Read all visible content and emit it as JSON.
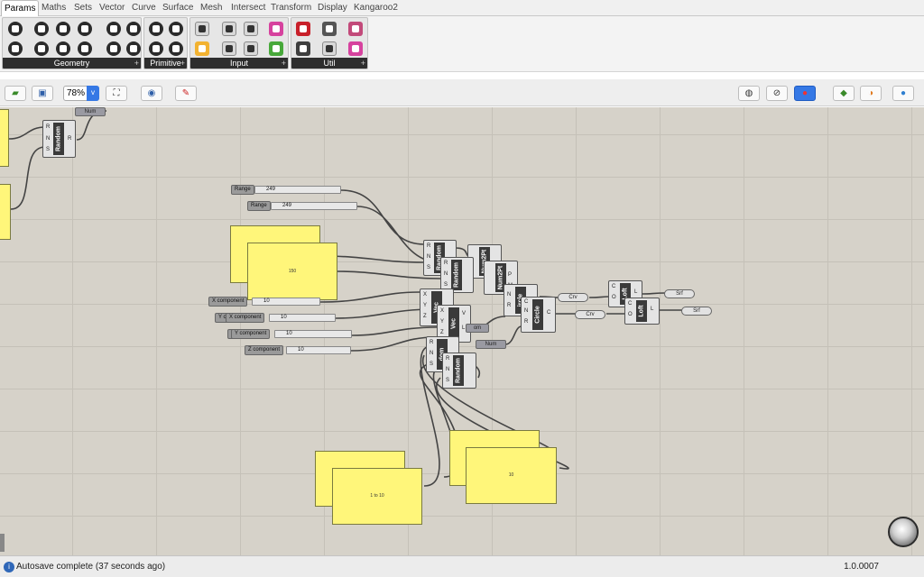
{
  "tabs": [
    "Params",
    "Maths",
    "Sets",
    "Vector",
    "Curve",
    "Surface",
    "Mesh",
    "Intersect",
    "Transform",
    "Display",
    "Kangaroo2"
  ],
  "active_tab": "Params",
  "ribbon": {
    "panels": [
      {
        "label": "Geometry",
        "more": "+"
      },
      {
        "label": "Primitive",
        "more": "+"
      },
      {
        "label": "Input",
        "more": "+"
      },
      {
        "label": "Util",
        "more": "+"
      }
    ],
    "primitive_icons": [
      "0",
      "01",
      "7",
      "A"
    ]
  },
  "toolbar": {
    "zoom": "78%",
    "zoom_arrow": "v",
    "icons": [
      "open-file-icon",
      "save-icon",
      "zoom-extents-icon",
      "eye-icon",
      "sketch-icon",
      "preview-wire-icon",
      "preview-shade-icon",
      "preview-selected-icon",
      "solid-preview-icon",
      "material-preview-icon",
      "sphere-preview-icon"
    ]
  },
  "canvas": {
    "components": {
      "random": "Random",
      "num2pt": "Num2Pt",
      "circle": "Circle",
      "vec": "Vec",
      "loft": "Loft"
    },
    "pins": {
      "r": "R",
      "n": "N",
      "s": "S",
      "x": "X",
      "y": "Y",
      "z": "Z",
      "c": "C",
      "p": "P",
      "m": "M",
      "o": "O",
      "l": "L",
      "v": "V"
    },
    "params": {
      "num": "Num",
      "crv": "Crv",
      "srf": "Srf"
    },
    "sliders": [
      {
        "label": "Range",
        "value": "249"
      },
      {
        "label": "Range",
        "value": "249"
      },
      {
        "label": "X component",
        "value": "10"
      },
      {
        "label": "Y c",
        "value": ""
      },
      {
        "label": "X component",
        "value": "10"
      },
      {
        "label": "Y component",
        "value": "10"
      },
      {
        "label": "Z",
        "value": ""
      },
      {
        "label": "Z component",
        "value": "10"
      }
    ],
    "panels": {
      "panel_150": "150",
      "panel_1to10": "1 to 10",
      "panel_10": "10"
    },
    "partial_labels": {
      "om": "om",
      "ircle": "ircle",
      "dom": "dom"
    }
  },
  "status": {
    "icon": "i",
    "message": "Autosave complete (37 seconds ago)",
    "version": "1.0.0007"
  },
  "colors": {
    "canvas": "#d6d2c9",
    "panel_yellow": "#fff67a",
    "active_blue": "#3578e5"
  }
}
